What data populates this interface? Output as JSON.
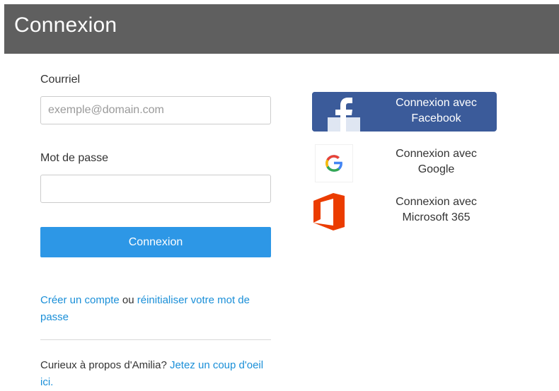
{
  "header": {
    "title": "Connexion"
  },
  "form": {
    "email_label": "Courriel",
    "email_placeholder": "exemple@domain.com",
    "email_value": "",
    "password_label": "Mot de passe",
    "password_value": "",
    "submit_label": "Connexion"
  },
  "links": {
    "create_account": "Créer un compte",
    "or": " ou ",
    "reset_password": "réinitialiser votre mot de passe",
    "curious": "Curieux à propos d'Amilia? ",
    "look": "Jetez un coup d'oeil ici."
  },
  "social": {
    "facebook_line1": "Connexion avec",
    "facebook_line2": "Facebook",
    "google_line1": "Connexion avec",
    "google_line2": "Google",
    "microsoft_line1": "Connexion avec",
    "microsoft_line2": "Microsoft 365",
    "icons": [
      "facebook-icon",
      "google-icon",
      "office-icon"
    ]
  },
  "colors": {
    "header_bg": "#5f5f5f",
    "primary": "#2d97e6",
    "link": "#1a8fd8",
    "facebook": "#3b5b9a",
    "office": "#eb3c00"
  }
}
